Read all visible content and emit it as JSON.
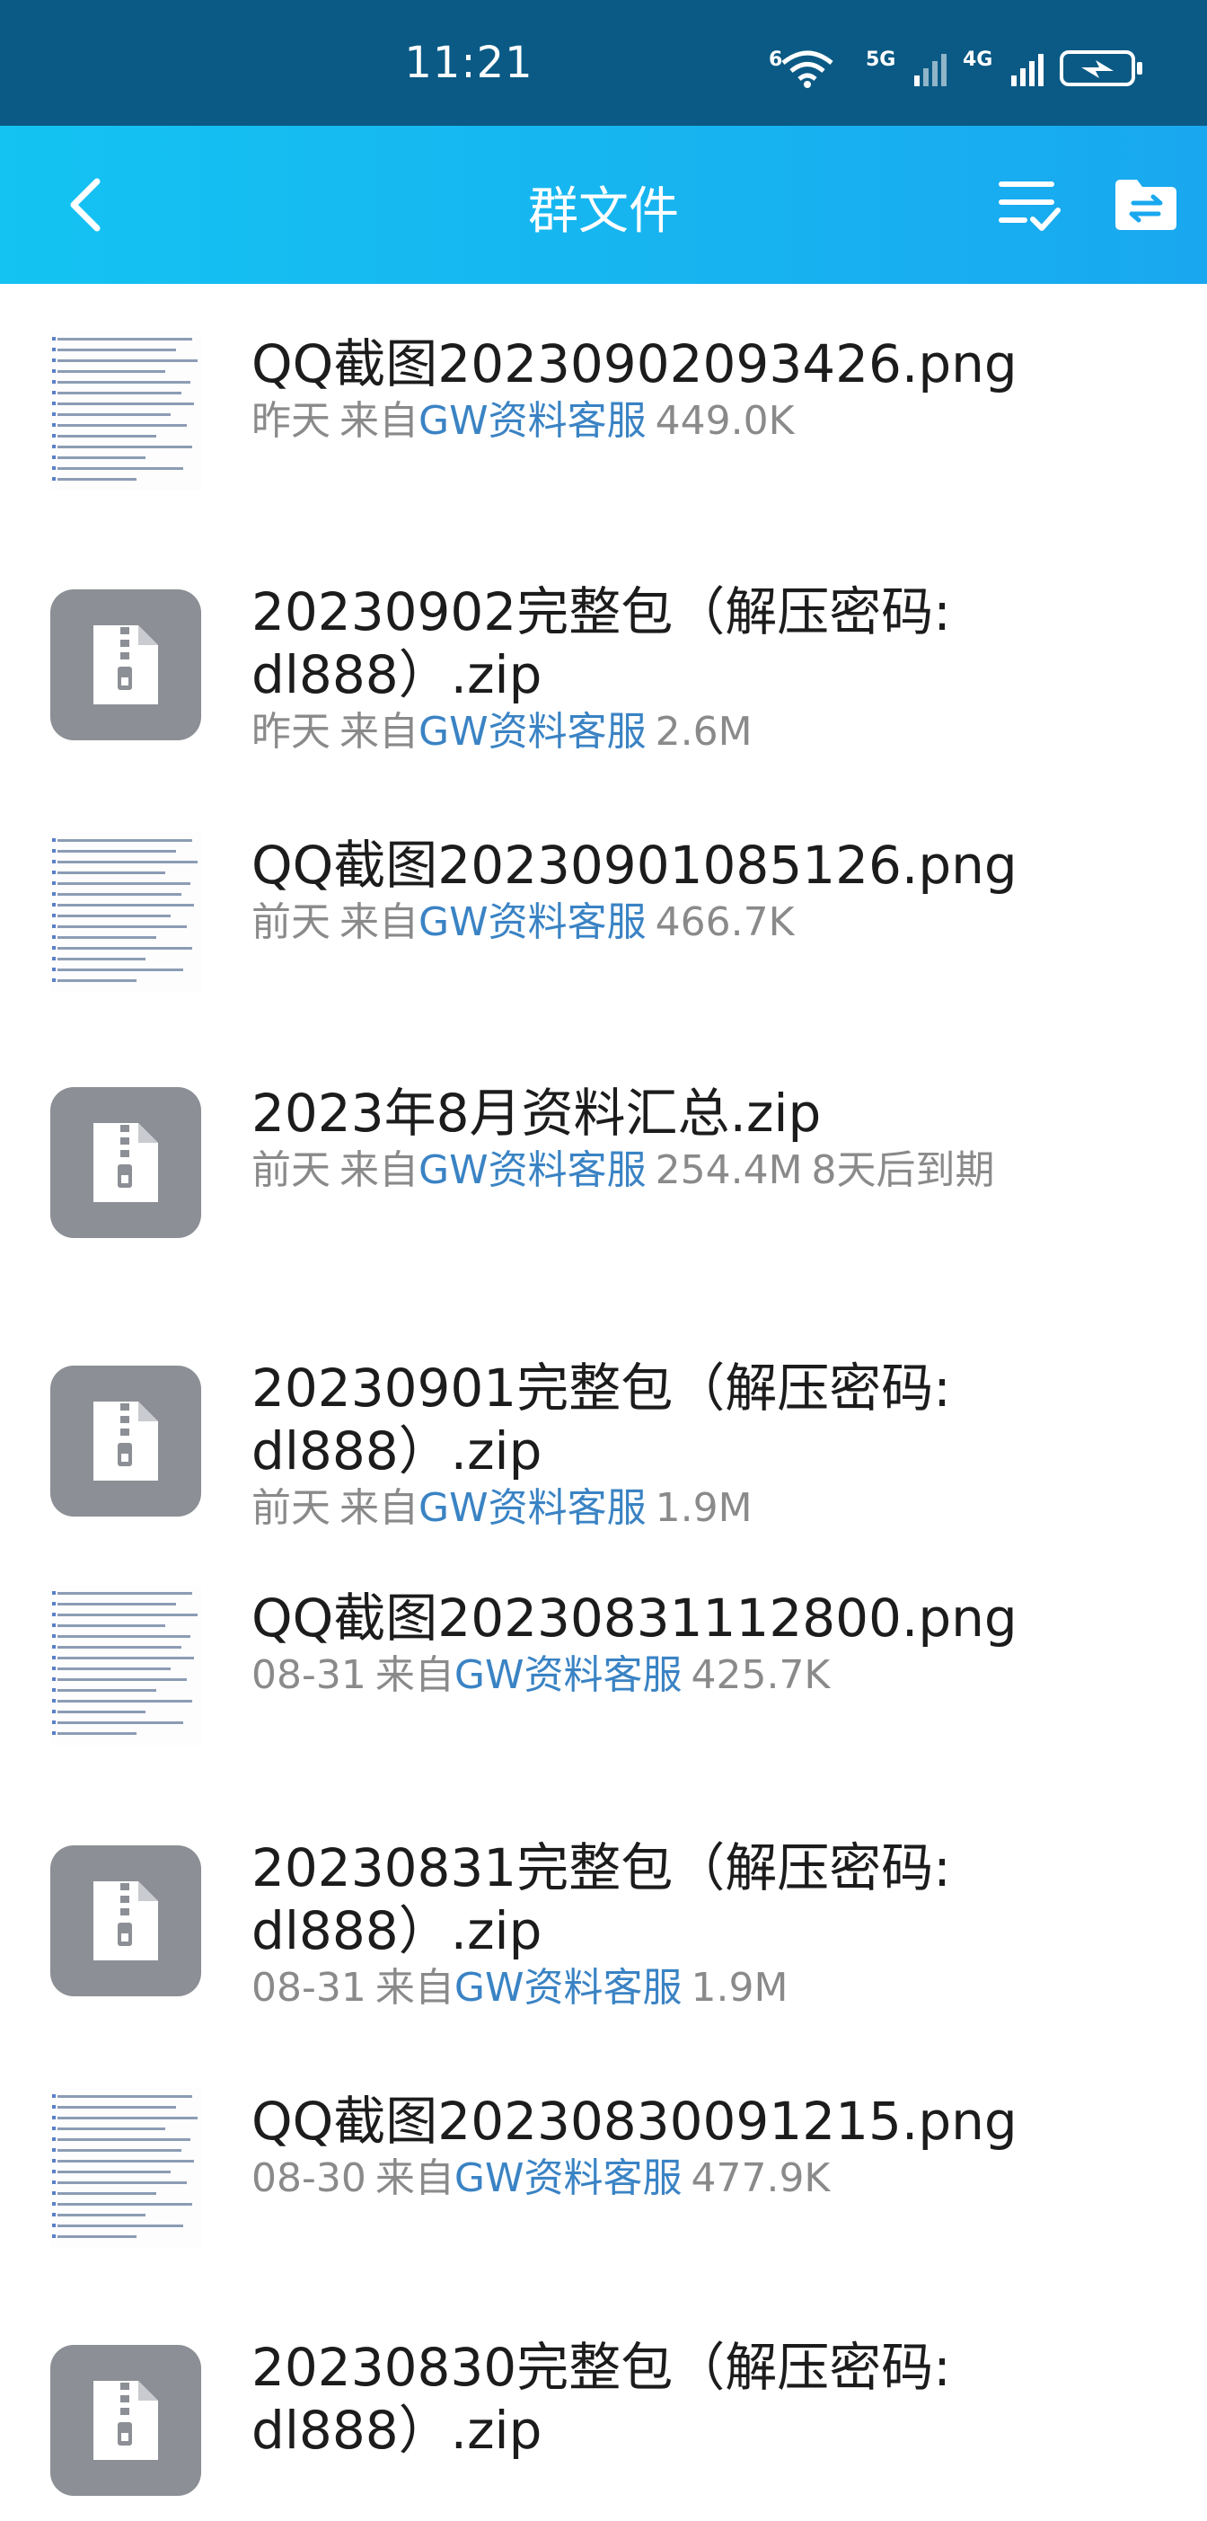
{
  "status_bar": {
    "time": "11:21",
    "networks": [
      "6",
      "5G",
      "4G"
    ],
    "wifi_icon": "wifi-icon",
    "battery_icon": "battery-charging-icon"
  },
  "header": {
    "title": "群文件",
    "back_icon": "chevron-left-icon",
    "sort_icon": "list-check-icon",
    "folder_icon": "folder-transfer-icon",
    "accent_color": "#14c3f2"
  },
  "files": [
    {
      "type": "image",
      "name_lines": [
        "QQ截图20230902093426.png"
      ],
      "day": "昨天",
      "from_prefix": "来自",
      "sender": "GW资料客服",
      "size": "449.0K",
      "expiry": ""
    },
    {
      "type": "zip",
      "name_lines": [
        "20230902完整包（解压密码:",
        "dl888）.zip"
      ],
      "day": "昨天",
      "from_prefix": "来自",
      "sender": "GW资料客服",
      "size": "2.6M",
      "expiry": ""
    },
    {
      "type": "image",
      "name_lines": [
        "QQ截图20230901085126.png"
      ],
      "day": "前天",
      "from_prefix": "来自",
      "sender": "GW资料客服",
      "size": "466.7K",
      "expiry": ""
    },
    {
      "type": "zip",
      "name_lines": [
        "2023年8月资料汇总.zip"
      ],
      "day": "前天",
      "from_prefix": "来自",
      "sender": "GW资料客服",
      "size": "254.4M",
      "expiry": "8天后到期"
    },
    {
      "type": "zip",
      "name_lines": [
        "20230901完整包（解压密码:",
        "dl888）.zip"
      ],
      "day": "前天",
      "from_prefix": "来自",
      "sender": "GW资料客服",
      "size": "1.9M",
      "expiry": ""
    },
    {
      "type": "image",
      "name_lines": [
        "QQ截图20230831112800.png"
      ],
      "day": "08-31",
      "from_prefix": "来自",
      "sender": "GW资料客服",
      "size": "425.7K",
      "expiry": ""
    },
    {
      "type": "zip",
      "name_lines": [
        "20230831完整包（解压密码:",
        "dl888）.zip"
      ],
      "day": "08-31",
      "from_prefix": "来自",
      "sender": "GW资料客服",
      "size": "1.9M",
      "expiry": ""
    },
    {
      "type": "image",
      "name_lines": [
        "QQ截图20230830091215.png"
      ],
      "day": "08-30",
      "from_prefix": "来自",
      "sender": "GW资料客服",
      "size": "477.9K",
      "expiry": ""
    },
    {
      "type": "zip",
      "name_lines": [
        "20230830完整包（解压密码:",
        "dl888）.zip"
      ],
      "day": "",
      "from_prefix": "",
      "sender": "",
      "size": "",
      "expiry": ""
    }
  ]
}
